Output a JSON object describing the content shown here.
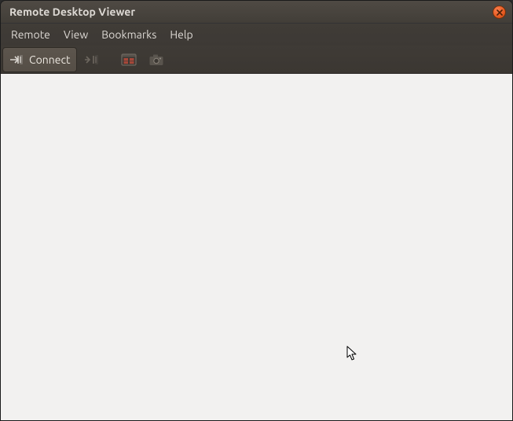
{
  "window": {
    "title": "Remote Desktop Viewer"
  },
  "menubar": {
    "items": [
      {
        "label": "Remote"
      },
      {
        "label": "View"
      },
      {
        "label": "Bookmarks"
      },
      {
        "label": "Help"
      }
    ]
  },
  "toolbar": {
    "connect_label": "Connect"
  }
}
